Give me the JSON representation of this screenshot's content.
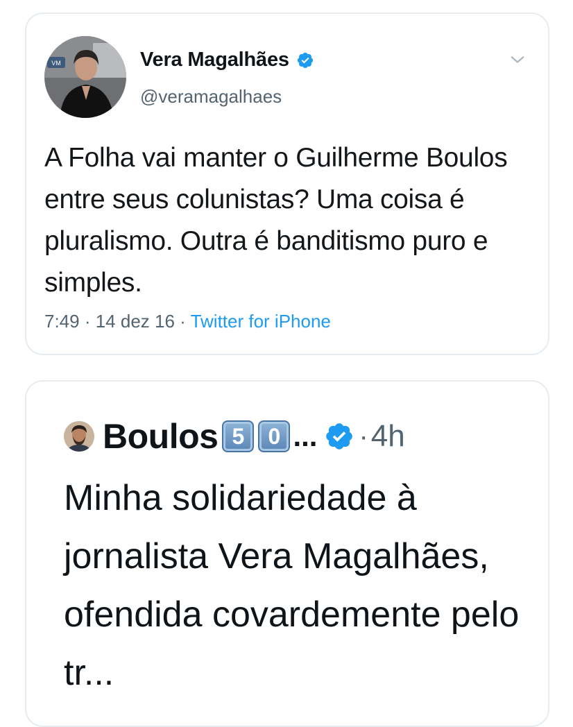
{
  "tweet1": {
    "display_name": "Vera Magalhães",
    "handle": "@veramagalhaes",
    "verified": true,
    "text": "A Folha vai manter o Guilherme Boulos entre seus colunistas? Uma coisa é pluralismo. Outra é banditismo puro e simples.",
    "time": "7:49",
    "sep1": " · ",
    "date": "14 dez 16",
    "sep2": " · ",
    "source": "Twitter for iPhone",
    "avatar_logo": "VM",
    "icons": {
      "verified": "verified-badge-icon",
      "more": "chevron-down-icon"
    }
  },
  "tweet2": {
    "display_name": "Boulos",
    "badge_digits": [
      "5",
      "0"
    ],
    "ellipsis": "...",
    "verified": true,
    "separator": "·",
    "time": "4h",
    "text": "Minha solidariedade à jornalista Vera Magalhães, ofendida covardemente pelo tr..."
  },
  "colors": {
    "accent_blue": "#1d9bf0",
    "text_primary": "#0f1419",
    "text_secondary": "#536471",
    "border": "#e6ecf0"
  }
}
